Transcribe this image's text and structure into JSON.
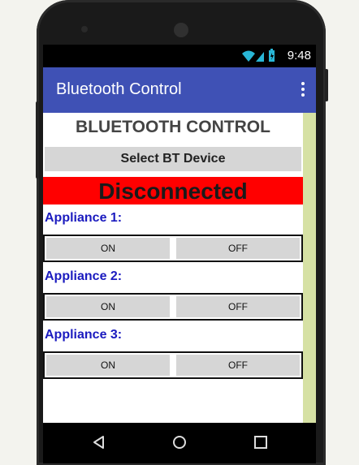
{
  "status_bar": {
    "time": "9:48",
    "icons": [
      "wifi-icon",
      "signal-icon",
      "battery-icon"
    ]
  },
  "app_bar": {
    "title": "Bluetooth Control",
    "menu_icon": "overflow-menu-icon"
  },
  "main": {
    "heading": "BLUETOOTH CONTROL",
    "select_button": "Select BT Device",
    "connection_status": "Disconnected",
    "appliances": [
      {
        "label": "Appliance 1:",
        "on": "ON",
        "off": "OFF"
      },
      {
        "label": "Appliance 2:",
        "on": "ON",
        "off": "OFF"
      },
      {
        "label": "Appliance 3:",
        "on": "ON",
        "off": "OFF"
      }
    ]
  },
  "nav_bar": {
    "icons": [
      "back-icon",
      "home-icon",
      "recents-icon"
    ]
  },
  "colors": {
    "app_bar": "#3f51b5",
    "status_disconnected": "#ff0000",
    "appliance_label": "#1b1bbf",
    "side_strip": "#d6e1a4"
  }
}
